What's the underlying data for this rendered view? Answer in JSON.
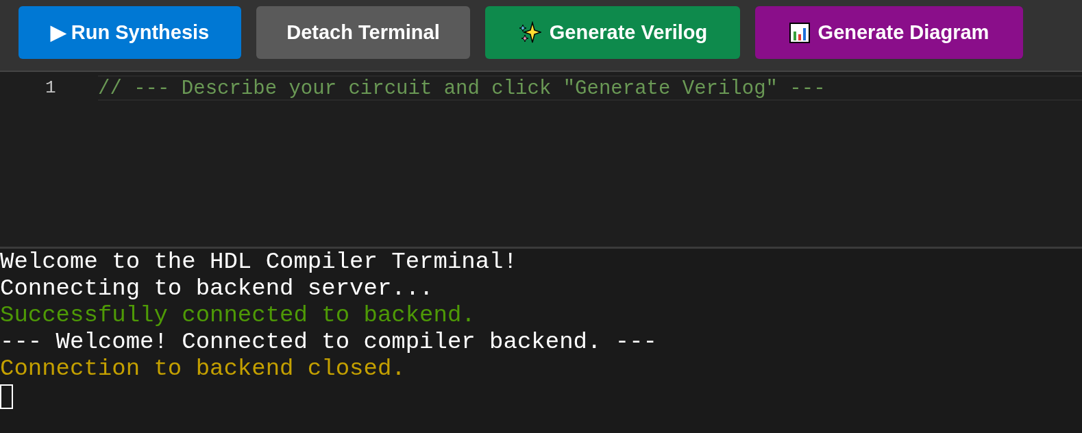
{
  "toolbar": {
    "buttons": [
      {
        "label": "▶ Run Synthesis",
        "color": "#0078d4"
      },
      {
        "label": "Detach Terminal",
        "color": "#5a5a5a"
      },
      {
        "label": "Generate Verilog",
        "color": "#0e8a4c"
      },
      {
        "label": "Generate Diagram",
        "color": "#8a0e8a"
      }
    ]
  },
  "editor": {
    "lines": [
      {
        "number": "1",
        "text": "// --- Describe your circuit and click \"Generate Verilog\" ---"
      }
    ]
  },
  "terminal": {
    "lines": [
      {
        "text": "Welcome to the HDL Compiler Terminal!",
        "color": "#ffffff"
      },
      {
        "text": "Connecting to backend server...",
        "color": "#ffffff"
      },
      {
        "text": "Successfully connected to backend.",
        "color": "#4e9a06"
      },
      {
        "text": "--- Welcome! Connected to compiler backend. ---",
        "color": "#ffffff"
      },
      {
        "text": "Connection to backend closed.",
        "color": "#c4a000"
      }
    ]
  }
}
